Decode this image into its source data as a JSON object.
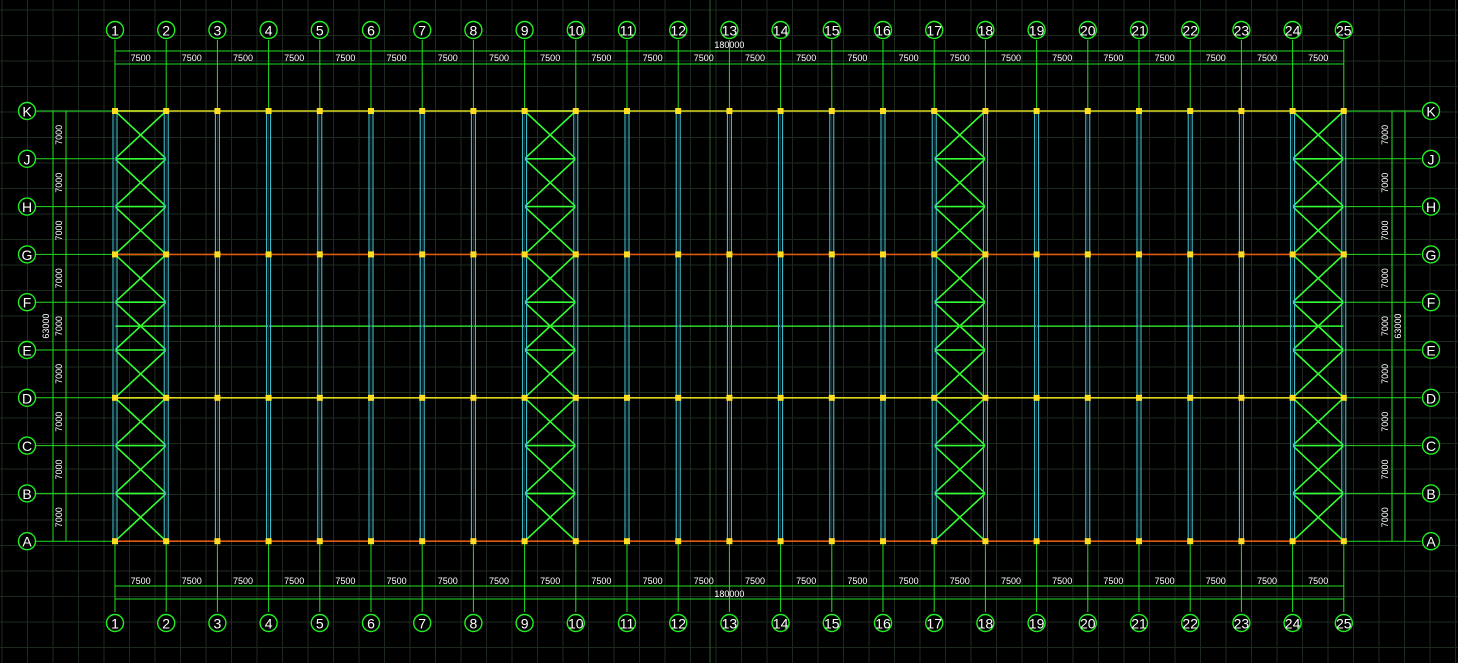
{
  "drawing": {
    "column_axes": [
      "1",
      "2",
      "3",
      "4",
      "5",
      "6",
      "7",
      "8",
      "9",
      "10",
      "11",
      "12",
      "13",
      "14",
      "15",
      "16",
      "17",
      "18",
      "19",
      "20",
      "21",
      "22",
      "23",
      "24",
      "25"
    ],
    "row_axes_top_to_bottom": [
      "K",
      "J",
      "H",
      "G",
      "F",
      "E",
      "D",
      "C",
      "B",
      "A"
    ],
    "bay_spacing_label": "7500",
    "row_spacing_label": "7000",
    "total_length_label": "180000",
    "total_width_label": "63000",
    "braced_bays": [
      [
        1,
        2
      ],
      [
        9,
        10
      ],
      [
        17,
        18
      ],
      [
        24,
        25
      ]
    ],
    "colors": {
      "background": "#000000",
      "grid": "#1e2a1e",
      "axis_line": "#22dd22",
      "bubble": "#22ee22",
      "bracing": "#33ff33",
      "purlin": "#d8d820",
      "main_beam": "#e05a10",
      "column": "#44ccdd",
      "dimension": "#22dd22",
      "text": "#ffffff"
    }
  }
}
